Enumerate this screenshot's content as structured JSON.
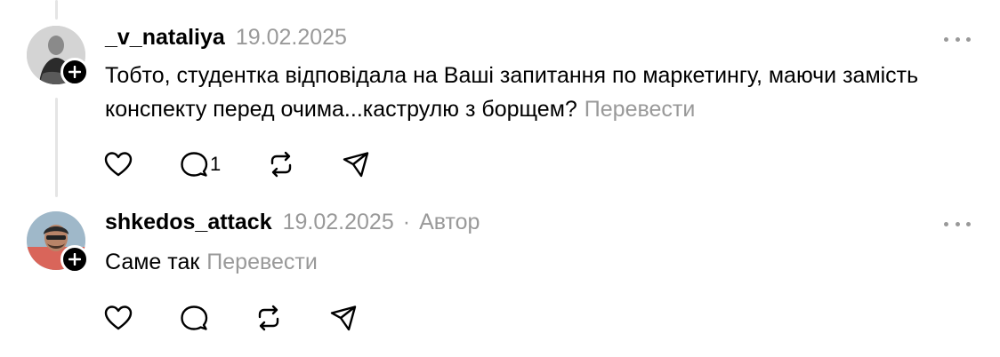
{
  "posts": [
    {
      "username": "_v_nataliya",
      "date": "19.02.2025",
      "author_label": "",
      "text": "Тобто, студентка відповідала на Ваші запитання по маркетингу, маючи замість конспекту перед очима...каструлю з борщем?",
      "translate": "Перевести",
      "reply_count": "1"
    },
    {
      "username": "shkedos_attack",
      "date": "19.02.2025",
      "separator": "·",
      "author_label": "Автор",
      "text": "Саме так",
      "translate": "Перевести",
      "reply_count": ""
    }
  ],
  "icons": [
    "plus-icon",
    "more-icon",
    "heart-icon",
    "comment-icon",
    "repost-icon",
    "share-icon"
  ]
}
